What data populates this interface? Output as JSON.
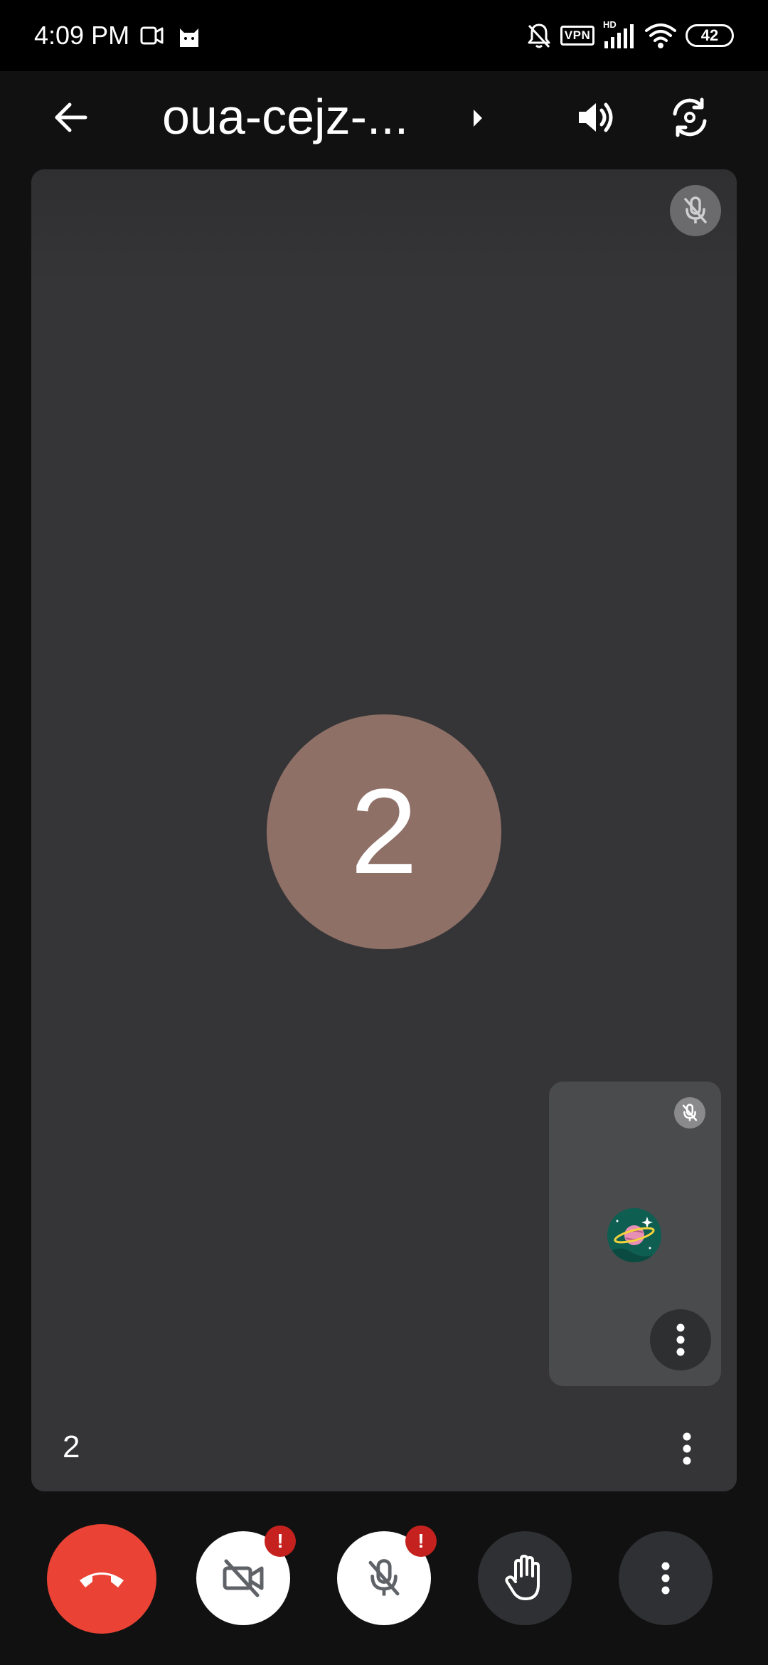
{
  "status_bar": {
    "time": "4:09 PM",
    "left_icons": [
      "video-record-icon",
      "cat-icon"
    ],
    "right_icons": [
      "bell-off-icon",
      "vpn-icon",
      "signal-icon",
      "wifi-icon",
      "battery-icon"
    ],
    "vpn_label": "VPN",
    "hd_label": "HD",
    "battery_level": "42"
  },
  "app_bar": {
    "meeting_code": "oua-cejz-...",
    "icons": [
      "back-arrow-icon",
      "chevron-right-icon",
      "speaker-icon",
      "switch-camera-icon"
    ]
  },
  "main_tile": {
    "avatar_text": "2",
    "avatar_color": "#8e7067",
    "participant_name": "2",
    "muted": true
  },
  "self_view": {
    "muted": true,
    "avatar_icon": "planet-avatar-icon"
  },
  "controls": {
    "end_call_color": "#ea4335",
    "camera_warning": "!",
    "mic_warning": "!",
    "icons": [
      "end-call-icon",
      "camera-off-icon",
      "mic-off-icon",
      "raise-hand-icon",
      "more-options-icon"
    ]
  }
}
